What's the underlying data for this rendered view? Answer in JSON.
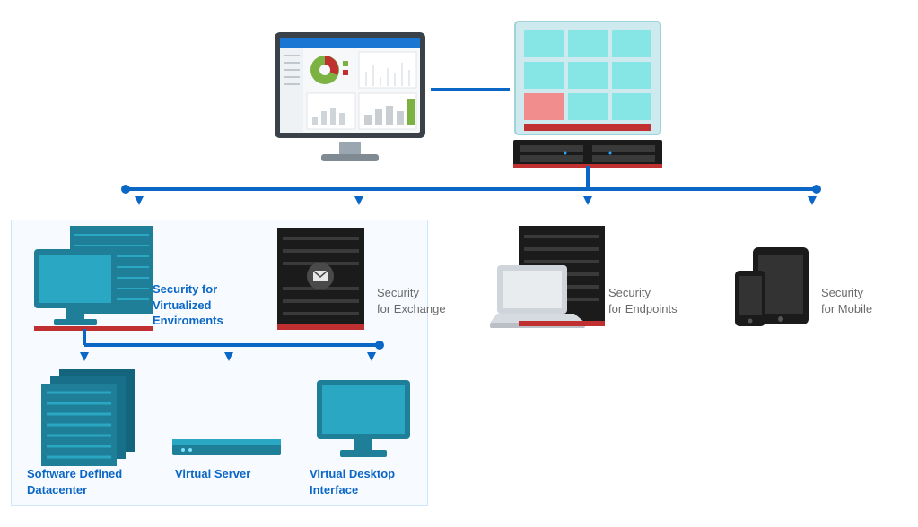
{
  "nodes": {
    "virtualized": {
      "label_l1": "Security for",
      "label_l2": "Virtualized",
      "label_l3": "Enviroments"
    },
    "exchange": {
      "label_l1": "Security",
      "label_l2": "for Exchange"
    },
    "endpoints": {
      "label_l1": "Security",
      "label_l2": "for Endpoints"
    },
    "mobile": {
      "label_l1": "Security",
      "label_l2": "for Mobile"
    },
    "sdd": {
      "label_l1": "Software Defined",
      "label_l2": "Datacenter"
    },
    "vserver": {
      "label_l1": "Virtual Server"
    },
    "vdi": {
      "label_l1": "Virtual Desktop",
      "label_l2": "Interface"
    }
  },
  "colors": {
    "accent_blue": "#0e6fd6",
    "line_blue": "#0b67c6",
    "teal_face": "#2aa7c3",
    "teal_dark": "#1f7f99",
    "panel_cyan": "#86e5e5",
    "panel_red": "#f28d8d",
    "rack_dark": "#2e2e2e",
    "rack_black": "#1b1b1b",
    "red_strip": "#c13031",
    "gray_text": "#6a6a6a",
    "light_high": "#dfe7ee",
    "highlight": "#e7f3ff"
  }
}
